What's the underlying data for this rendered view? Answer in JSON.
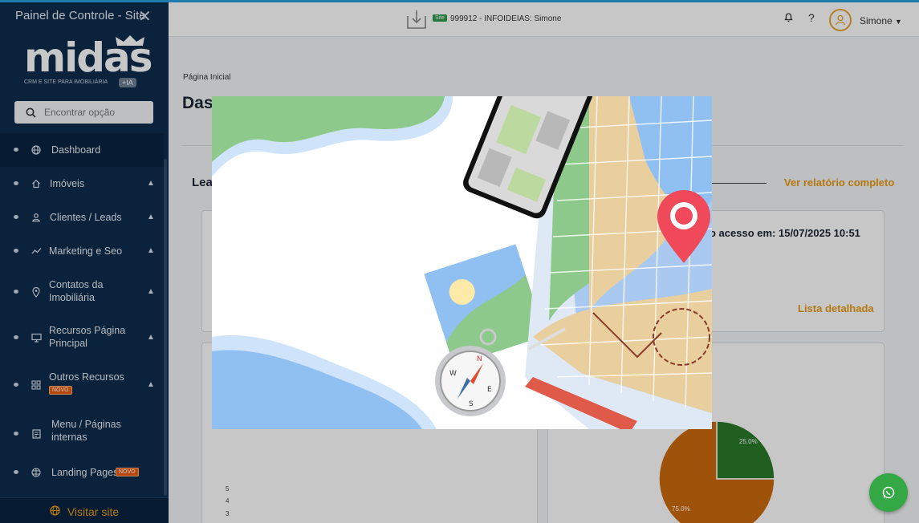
{
  "sidebar": {
    "title": "Painel de Controle - Site",
    "logo": {
      "word": "midas",
      "tagline": "CRM E SITE PARA IMOBILIÁRIA",
      "ia": "+IA"
    },
    "search_placeholder": "Encontrar opção",
    "items": [
      {
        "label": "Dashboard",
        "icon": "globe-icon"
      },
      {
        "label": "Imóveis",
        "icon": "home-icon"
      },
      {
        "label": "Clientes / Leads",
        "icon": "user-icon"
      },
      {
        "label": "Marketing e Seo",
        "icon": "trend-icon"
      },
      {
        "label": "Contatos da Imobiliária",
        "icon": "pin-icon"
      },
      {
        "label": "Recursos Página Principal",
        "icon": "monitor-icon"
      },
      {
        "label": "Outros Recursos",
        "icon": "grid-icon",
        "badge": "NOVO"
      },
      {
        "label": "Menu / Páginas internas",
        "icon": "page-icon"
      },
      {
        "label": "Landing Pages",
        "icon": "web-icon",
        "badge": "NOVO"
      }
    ],
    "footer": "Visitar site"
  },
  "header": {
    "site_badge": "Site",
    "site_text": "999912 - INFOIDEIAS: Simone",
    "help": "?",
    "user": "Simone"
  },
  "main": {
    "breadcrumb": "Página Inicial",
    "title_visible": "Das",
    "section_visible": "Lea",
    "report_link": "Ver relatório completo",
    "last_access": "o acesso em: 15/07/2025 10:51",
    "list_link": "Lista detalhada",
    "yticks": [
      "5",
      "4",
      "3"
    ],
    "pie_labels": [
      "25.0%",
      "75.0%"
    ]
  },
  "chart_data": {
    "type": "pie",
    "categories": [
      "",
      ""
    ],
    "values": [
      25.0,
      75.0
    ],
    "colors": [
      "#2a7a2a",
      "#cc6a0e"
    ]
  },
  "colors": {
    "sidebar": "#0d2c4c",
    "accent": "#e89a16",
    "topline": "#2a9fe0",
    "whatsapp": "#33a845"
  }
}
